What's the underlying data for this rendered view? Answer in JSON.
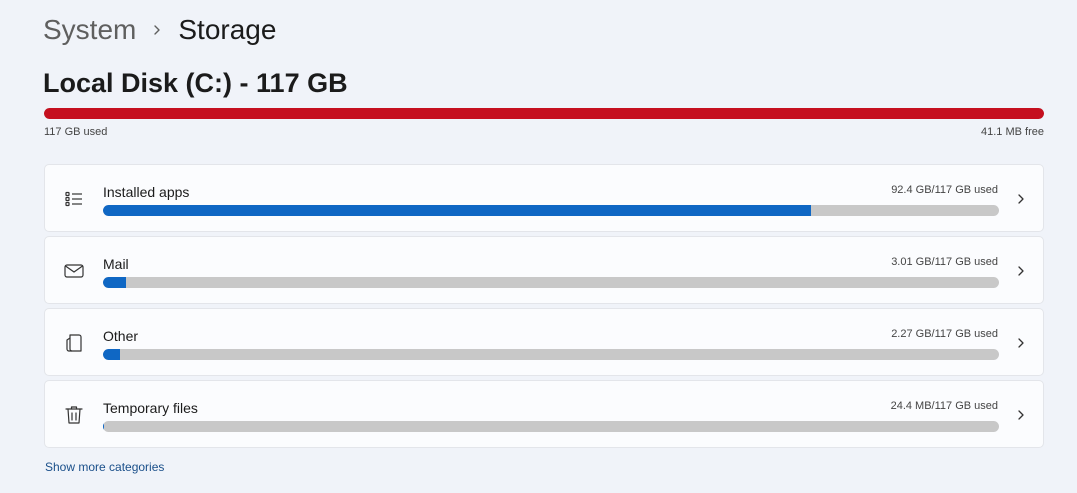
{
  "breadcrumb": {
    "parent": "System",
    "separator_icon": "chevron-right-icon",
    "current": "Storage"
  },
  "disk": {
    "title": "Local Disk (C:) - 117 GB",
    "used_label": "117 GB used",
    "free_label": "41.1 MB free",
    "used_fraction": 0.9997,
    "bar_color": "#c50f1f"
  },
  "categories": [
    {
      "label": "Installed apps",
      "usage": "92.4 GB/117 GB used",
      "icon": "list-icon",
      "fraction": 0.79
    },
    {
      "label": "Mail",
      "usage": "3.01 GB/117 GB used",
      "icon": "mail-icon",
      "fraction": 0.0257
    },
    {
      "label": "Other",
      "usage": "2.27 GB/117 GB used",
      "icon": "document-icon",
      "fraction": 0.0194
    },
    {
      "label": "Temporary files",
      "usage": "24.4 MB/117 GB used",
      "icon": "trash-icon",
      "fraction": 0.0002
    }
  ],
  "category_bar_color": "#0f67c4",
  "show_more_label": "Show more categories"
}
